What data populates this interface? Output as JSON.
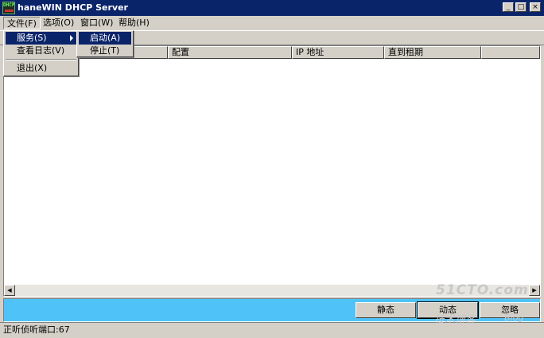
{
  "window": {
    "title": "haneWIN DHCP Server"
  },
  "menubar": [
    {
      "label": "文件(F)"
    },
    {
      "label": "选项(O)"
    },
    {
      "label": "窗口(W)"
    },
    {
      "label": "帮助(H)"
    }
  ],
  "file_menu": {
    "items": [
      {
        "label": "服务(S)"
      },
      {
        "label": "查看日志(V)"
      },
      {
        "label": "退出(X)"
      }
    ]
  },
  "service_submenu": {
    "items": [
      {
        "label": "启动(A)"
      },
      {
        "label": "停止(T)"
      }
    ]
  },
  "list": {
    "columns": [
      {
        "label": ""
      },
      {
        "label": "配置"
      },
      {
        "label": "IP 地址"
      },
      {
        "label": "直到租期"
      },
      {
        "label": ""
      }
    ]
  },
  "actions": {
    "static_label": "静态",
    "dynamic_label": "动态",
    "ignore_label": "忽略"
  },
  "status": {
    "text": "正听侦听端口:67"
  },
  "watermark": {
    "logo": "51CTO.com",
    "sub": "技术博客",
    "blog": "Blog"
  },
  "colors": {
    "titlebar": "#0a246a",
    "action_band": "#4fc3f7",
    "highlight": "#0a246a"
  }
}
